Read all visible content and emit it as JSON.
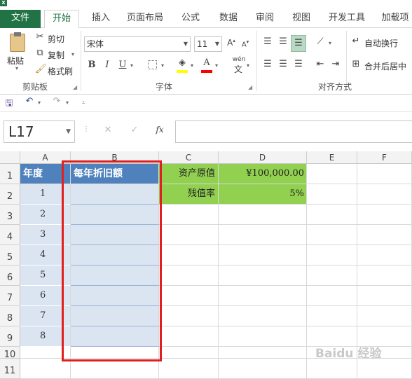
{
  "app": {
    "logo": "X"
  },
  "tabs": [
    "文件",
    "开始",
    "插入",
    "页面布局",
    "公式",
    "数据",
    "审阅",
    "视图",
    "开发工具",
    "加载项"
  ],
  "ribbon": {
    "clipboard": {
      "paste": "粘贴",
      "cut": "剪切",
      "copy": "复制",
      "format_painter": "格式刷",
      "label": "剪贴板"
    },
    "font": {
      "name": "宋体",
      "size": "11",
      "bold": "B",
      "italic": "I",
      "underline": "U",
      "phonetic": "wén",
      "label": "字体",
      "font_color": "#ff0000",
      "fill_color": "#ffff00"
    },
    "alignment": {
      "wrap": "自动换行",
      "merge": "合并后居中",
      "label": "对齐方式"
    }
  },
  "formula_bar": {
    "name_box": "L17",
    "fx": "fx",
    "value": ""
  },
  "sheet": {
    "columns": [
      "A",
      "B",
      "C",
      "D",
      "E",
      "F"
    ],
    "rows": [
      "1",
      "2",
      "3",
      "4",
      "5",
      "6",
      "7",
      "8",
      "9",
      "10",
      "11"
    ],
    "a1": "年度",
    "b1": "每年折旧额",
    "years": [
      "1",
      "2",
      "3",
      "4",
      "5",
      "6",
      "7",
      "8"
    ],
    "c1": "资产原值",
    "d1": "¥100,000.00",
    "c2": "残值率",
    "d2": "5%"
  },
  "watermark": "Baidu 经验"
}
